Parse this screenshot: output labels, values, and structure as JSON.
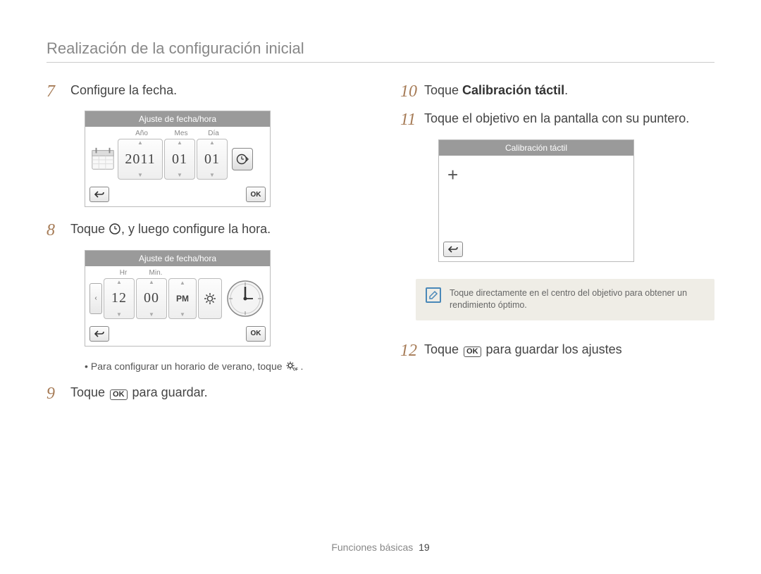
{
  "page_title": "Realización de la configuración inicial",
  "left": {
    "step7": {
      "num": "7",
      "text": "Configure la fecha."
    },
    "date_screen": {
      "title": "Ajuste de fecha/hora",
      "labels": {
        "year": "Año",
        "month": "Mes",
        "day": "Día"
      },
      "values": {
        "year": "2011",
        "month": "01",
        "day": "01"
      },
      "ok": "OK"
    },
    "step8": {
      "num": "8",
      "pre": "Toque ",
      "post": ", y luego configure la hora."
    },
    "time_screen": {
      "title": "Ajuste de fecha/hora",
      "labels": {
        "hr": "Hr",
        "min": "Min."
      },
      "values": {
        "hr": "12",
        "min": "00",
        "ampm": "PM"
      },
      "ok": "OK"
    },
    "sub_note": {
      "bullet": "•",
      "pre": "Para configurar un horario de verano, toque ",
      "post": "."
    },
    "step9": {
      "num": "9",
      "pre": "Toque ",
      "ok": "OK",
      "post": " para guardar."
    }
  },
  "right": {
    "step10": {
      "num": "10",
      "pre": "Toque ",
      "bold": "Calibración táctil",
      "post": "."
    },
    "step11": {
      "num": "11",
      "text": "Toque el objetivo en la pantalla con su puntero."
    },
    "calib_screen": {
      "title": "Calibración táctil"
    },
    "tip": "Toque directamente en el centro del objetivo para obtener un rendimiento óptimo.",
    "step12": {
      "num": "12",
      "pre": "Toque ",
      "ok": "OK",
      "post": " para guardar los ajustes"
    }
  },
  "footer": {
    "section": "Funciones básicas",
    "page": "19"
  }
}
